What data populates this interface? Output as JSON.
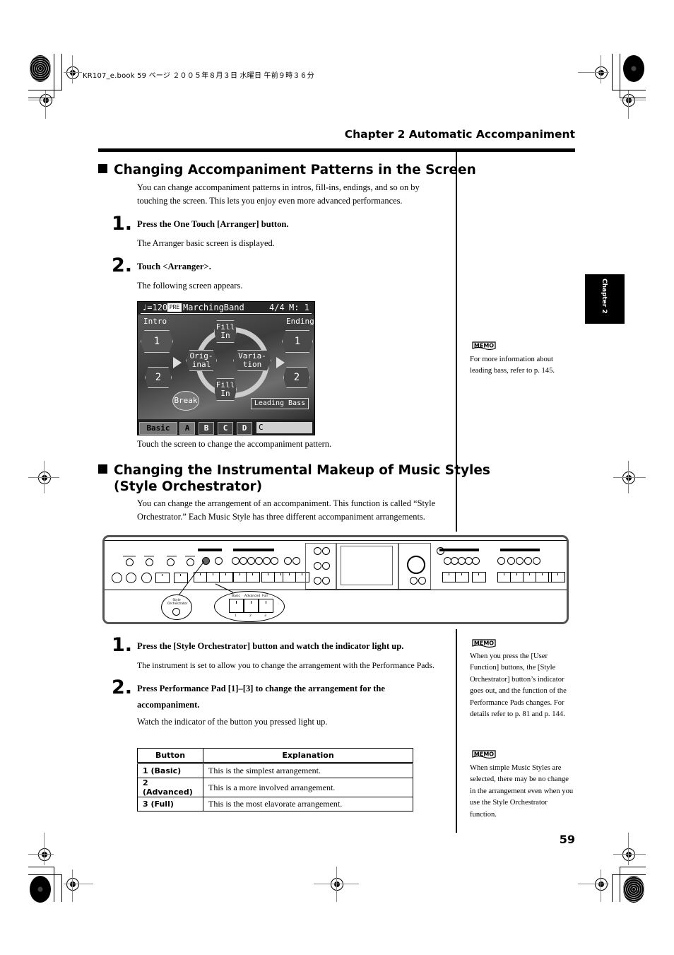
{
  "print_info": "KR107_e.book  59 ページ  ２００５年８月３日  水曜日  午前９時３６分",
  "chapter_header": "Chapter 2 Automatic Accompaniment",
  "chapter_tab": "Chapter 2",
  "page_number": "59",
  "section1": {
    "title": "Changing Accompaniment Patterns in the Screen",
    "intro": "You can change accompaniment patterns in intros, fill-ins, endings, and so on by touching the screen. This lets you enjoy even more advanced performances.",
    "steps": [
      {
        "num": "1.",
        "text": "Press the One Touch [Arranger] button.",
        "result": "The Arranger basic screen is displayed."
      },
      {
        "num": "2.",
        "text": "Touch <Arranger>.",
        "result": "The following screen appears."
      }
    ],
    "screen": {
      "tempo": "♩=120",
      "style_icon": "PRE",
      "style_name": "MarchingBand",
      "meter": "4/4",
      "measure": "M:  1",
      "intro_label": "Intro",
      "ending_label": "Ending",
      "intro_buttons": [
        "1",
        "2"
      ],
      "ending_buttons": [
        "1",
        "2"
      ],
      "original": "Orig-\ninal",
      "variation": "Varia-\ntion",
      "fill_in_top": "Fill\nIn",
      "fill_in_bottom": "Fill\nIn",
      "break": "Break",
      "leading_bass": "Leading Bass",
      "tabs": [
        "Basic",
        "A",
        "B",
        "C",
        "D"
      ],
      "chord": "C"
    },
    "caption": "Touch the screen to change the accompaniment pattern."
  },
  "section2": {
    "title_line1": "Changing the Instrumental Makeup of Music Styles",
    "title_line2": "(Style Orchestrator)",
    "intro": "You can change the arrangement of an accompaniment. This function is called “Style Orchestrator.” Each Music Style has three different accompaniment arrangements.",
    "panel_callouts": {
      "style_orchestrator": "Style\nOrchestrator",
      "pads": [
        "Basic",
        "Advanced",
        "Full"
      ],
      "pad_numbers": [
        "1",
        "2",
        "3"
      ]
    },
    "steps": [
      {
        "num": "1.",
        "text": "Press the [Style Orchestrator] button and watch the indicator light up.",
        "result": "The instrument is set to allow you to change the arrangement with the Performance Pads."
      },
      {
        "num": "2.",
        "text": "Press Performance Pad [1]–[3] to change the arrangement for the accompaniment.",
        "result": "Watch the indicator of the button you pressed light up."
      }
    ],
    "table": {
      "headers": [
        "Button",
        "Explanation"
      ],
      "rows": [
        [
          "1 (Basic)",
          "This is the simplest arrangement."
        ],
        [
          "2 (Advanced)",
          "This is a more involved arrangement."
        ],
        [
          "3 (Full)",
          "This is the most elavorate arrangement."
        ]
      ]
    }
  },
  "memos": [
    {
      "icon": "MEMO",
      "text": "For more information about leading bass, refer to p. 145."
    },
    {
      "icon": "MEMO",
      "text": "When you press the [User Function] buttons, the [Style Orchestrator] button’s indicator goes out, and the function of the Performance Pads changes. For details refer to p. 81 and p. 144."
    },
    {
      "icon": "MEMO",
      "text": "When simple Music Styles are selected, there may be no change in the arrangement even when you use the Style Orchestrator function."
    }
  ]
}
